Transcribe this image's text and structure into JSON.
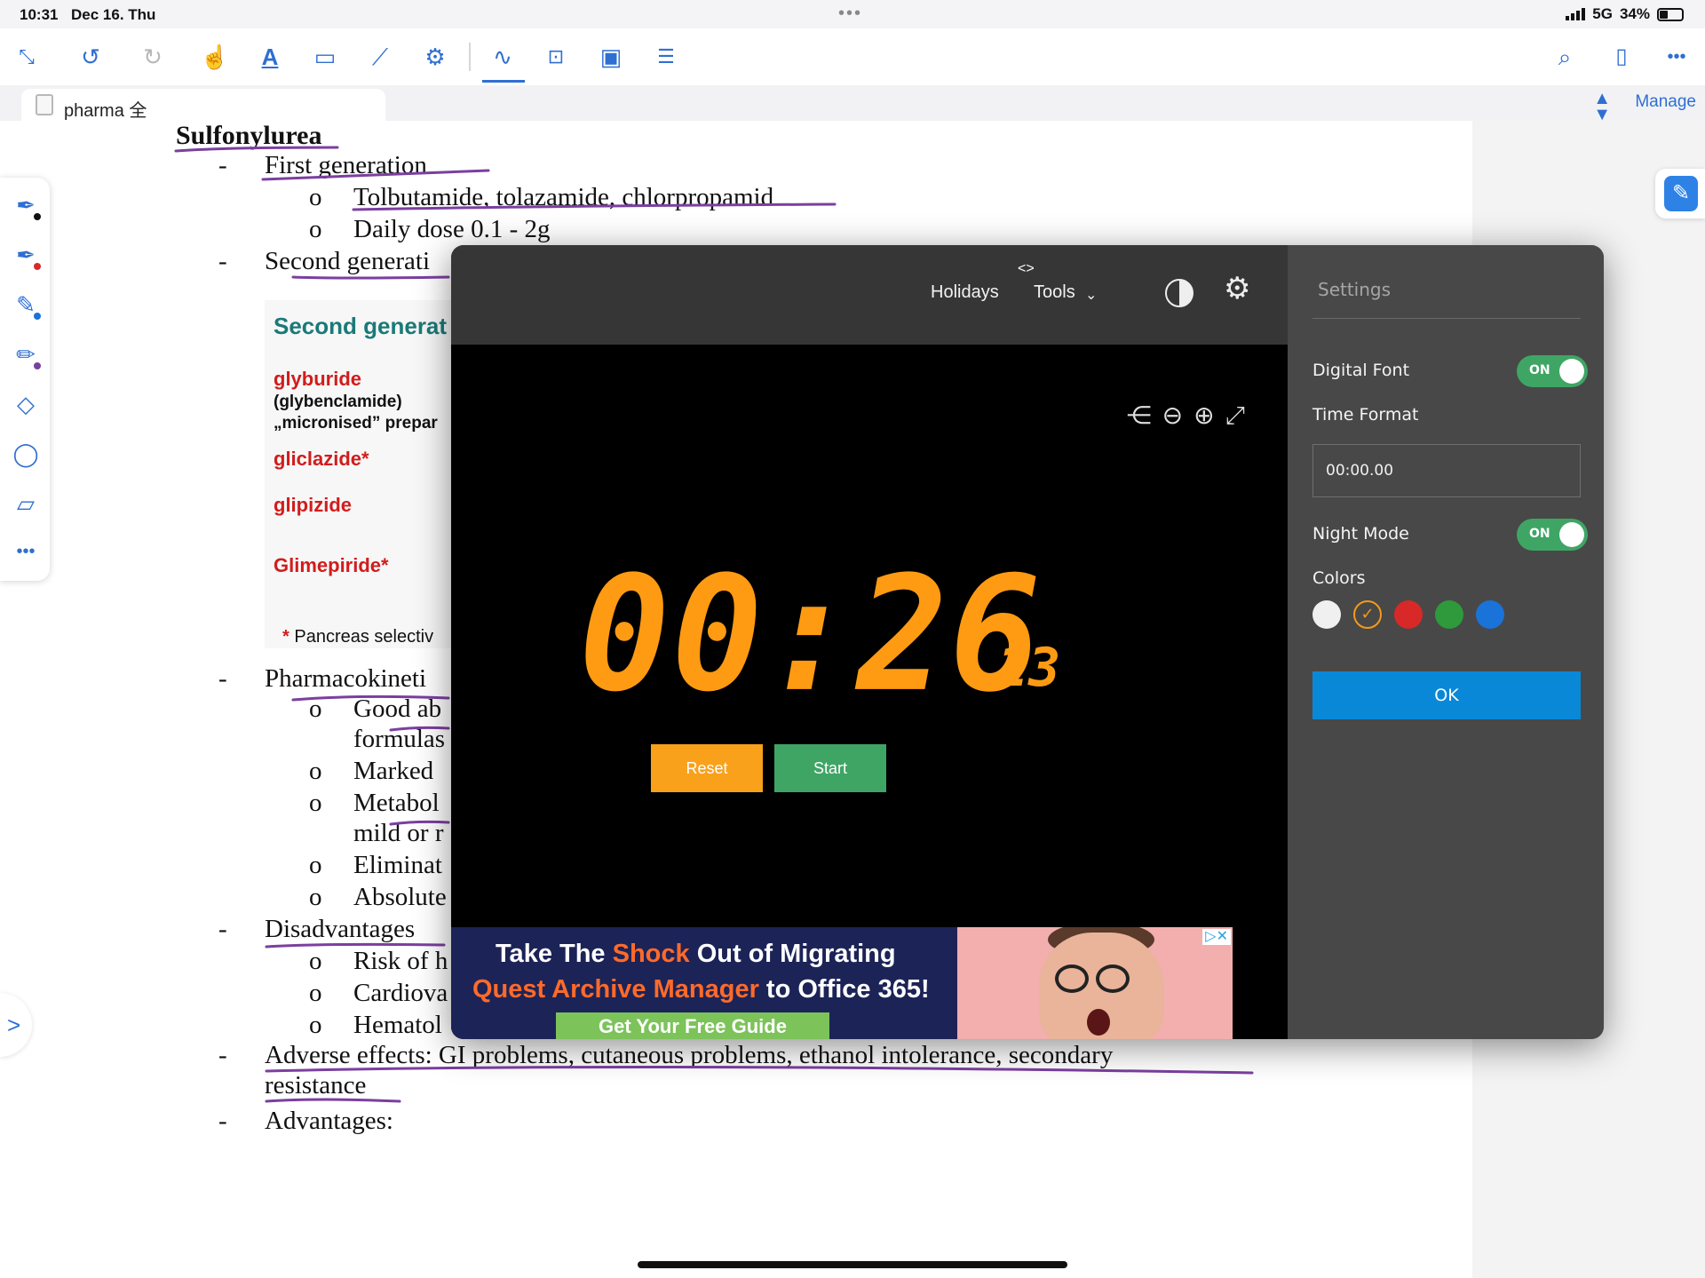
{
  "status": {
    "time": "10:31",
    "date": "Dec 16. Thu",
    "network": "5G",
    "battery": "34%"
  },
  "toolbar": {
    "icons": [
      "collapse-icon",
      "undo-icon",
      "redo-icon",
      "hand-pointer-icon",
      "text-highlight-icon",
      "selection-rect-icon",
      "shape-icon",
      "stamp-gear-icon",
      "pen-stroke-icon",
      "text-box-icon",
      "image-icon",
      "list-icon",
      "search-icon",
      "bookmark-icon",
      "more-icon"
    ]
  },
  "tabs": {
    "active": "pharma 全",
    "manage": "Manage"
  },
  "document": {
    "title": "Sulfonylurea",
    "lines": {
      "first_gen": "First generation",
      "tolbutamide": "Tolbutamide, tolazamide, chlorpropamid",
      "daily_dose": "Daily dose 0.1 - 2g",
      "second_gen": "Second generati",
      "pharmacokinetics": "Pharmacokineti",
      "good_ab": "Good ab",
      "formulas": "formulas",
      "marked": "Marked",
      "metabol": "Metabol",
      "mild_or": "mild or r",
      "eliminat": "Eliminat",
      "absolute": "Absolute",
      "disadvantages": "Disadvantages",
      "risk_of": "Risk of h",
      "cardiova": "Cardiova",
      "hematol": "Hematol",
      "adverse": "Adverse effects: GI problems, cutaneous problems, ethanol intolerance, secondary",
      "resistance": "resistance",
      "advantages": "Advantages:"
    },
    "bullets": {
      "dash": "-",
      "circle": "o"
    },
    "embedded_image": {
      "header": "Second generat",
      "glyburide": "glyburide",
      "glybenclamide": "(glybenclamide)",
      "micronised": "„micronised” prepar",
      "gliclazide": "gliclazide*",
      "glipizide": "glipizide",
      "glimepiride": "Glimepiride*",
      "footnote_star": "*",
      "footnote": "Pancreas selectiv"
    }
  },
  "stopwatch": {
    "code_toggle": "<>",
    "nav": {
      "holidays": "Holidays",
      "tools": "Tools"
    },
    "time_main": "00:26",
    "time_dot": ".",
    "time_fraction": "13",
    "reset_label": "Reset",
    "start_label": "Start",
    "display_color": "#ff9b12"
  },
  "ad": {
    "line1_a": "Take The ",
    "line1_highlight": "Shock",
    "line1_b": " Out of Migrating",
    "line2_highlight": "Quest Archive Manager",
    "line2_b": " to Office 365!",
    "cta": "Get Your Free Guide"
  },
  "settings": {
    "title": "Settings",
    "digital_font": {
      "label": "Digital Font",
      "state": "ON"
    },
    "time_format": {
      "label": "Time Format",
      "value": "00:00.00"
    },
    "night_mode": {
      "label": "Night Mode",
      "state": "ON"
    },
    "colors_label": "Colors",
    "colors": [
      "#f0f0f0",
      "#f39a1b",
      "#d92828",
      "#2e9a3c",
      "#1a73d9"
    ],
    "selected_color": "#f39a1b",
    "ok_label": "OK"
  }
}
